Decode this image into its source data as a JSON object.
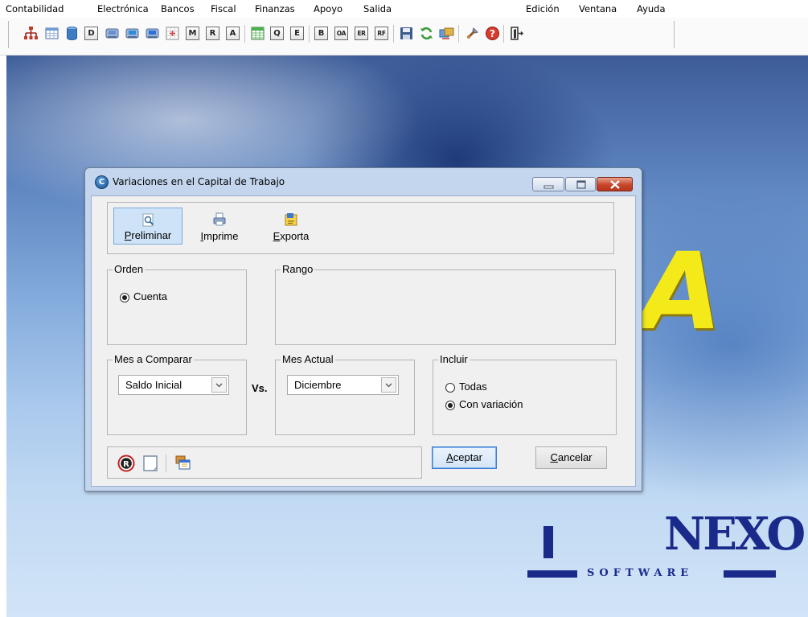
{
  "menubar": {
    "items": [
      "Contabilidad",
      "Electrónica",
      "Bancos",
      "Fiscal",
      "Finanzas",
      "Apoyo",
      "Salida",
      "Edición",
      "Ventana",
      "Ayuda"
    ]
  },
  "toolbar": {
    "letter_buttons": [
      "D",
      "M",
      "R",
      "A",
      "Q",
      "E",
      "B",
      "OA",
      "ER",
      "RF"
    ],
    "icons": [
      "org-chart-icon",
      "table-icon",
      "database-icon",
      "db-report-icon",
      "db-report-icon",
      "db-report-icon",
      "grid-plus-icon",
      "spreadsheet-icon",
      "save-icon",
      "refresh-icon",
      "transfer-icon",
      "tools-icon",
      "help-icon",
      "exit-icon"
    ]
  },
  "background": {
    "brand_letter": "A",
    "brand_word": "NEXO",
    "brand_sub": "SOFTWARE",
    "accent_yellow": "#f4ea1a",
    "brand_blue": "#1a2a8a"
  },
  "dialog": {
    "title": "Variaciones en el Capital de Trabajo",
    "tools": {
      "preliminar_u": "P",
      "preliminar_rest": "reliminar",
      "imprime_u": "I",
      "imprime_rest": "mprime",
      "exporta_u": "E",
      "exporta_rest": "xporta"
    },
    "orden": {
      "legend": "Orden",
      "option": "Cuenta"
    },
    "rango": {
      "legend": "Rango"
    },
    "mes_comparar": {
      "legend": "Mes a Comparar",
      "value": "Saldo Inicial"
    },
    "vs_label": "Vs.",
    "mes_actual": {
      "legend": "Mes Actual",
      "value": "Diciembre"
    },
    "incluir": {
      "legend": "Incluir",
      "options": [
        "Todas",
        "Con variación"
      ],
      "selected": "Con variación"
    },
    "buttons": {
      "aceptar_u": "A",
      "aceptar_rest": "ceptar",
      "cancelar_u": "C",
      "cancelar_rest": "ancelar"
    }
  }
}
